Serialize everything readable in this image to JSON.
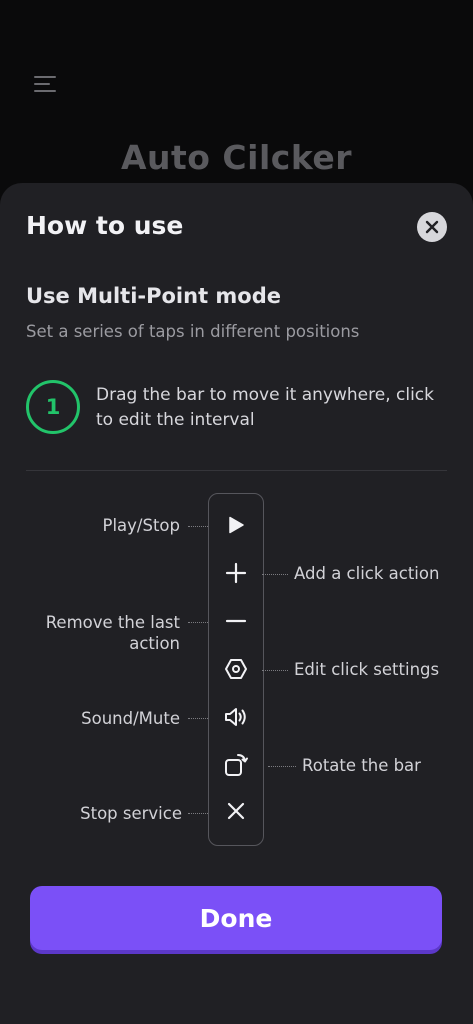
{
  "background": {
    "app_title": "Auto Cilcker"
  },
  "sheet": {
    "title": "How to use",
    "mode_title": "Use Multi-Point mode",
    "mode_subtitle": "Set a series of taps in different positions",
    "step_number": "1",
    "step_text": "Drag the bar to move it anywhere, click to edit the interval",
    "done_label": "Done"
  },
  "toolbar_labels": {
    "play_stop": "Play/Stop",
    "add_click": "Add a click action",
    "remove_last_line1": "Remove the last",
    "remove_last_line2": "action",
    "edit_settings": "Edit click settings",
    "sound_mute": "Sound/Mute",
    "rotate_bar": "Rotate the bar",
    "stop_service": "Stop service"
  },
  "colors": {
    "accent": "#7b50f7",
    "step_green": "#22c46a",
    "sheet_bg": "#202024"
  }
}
